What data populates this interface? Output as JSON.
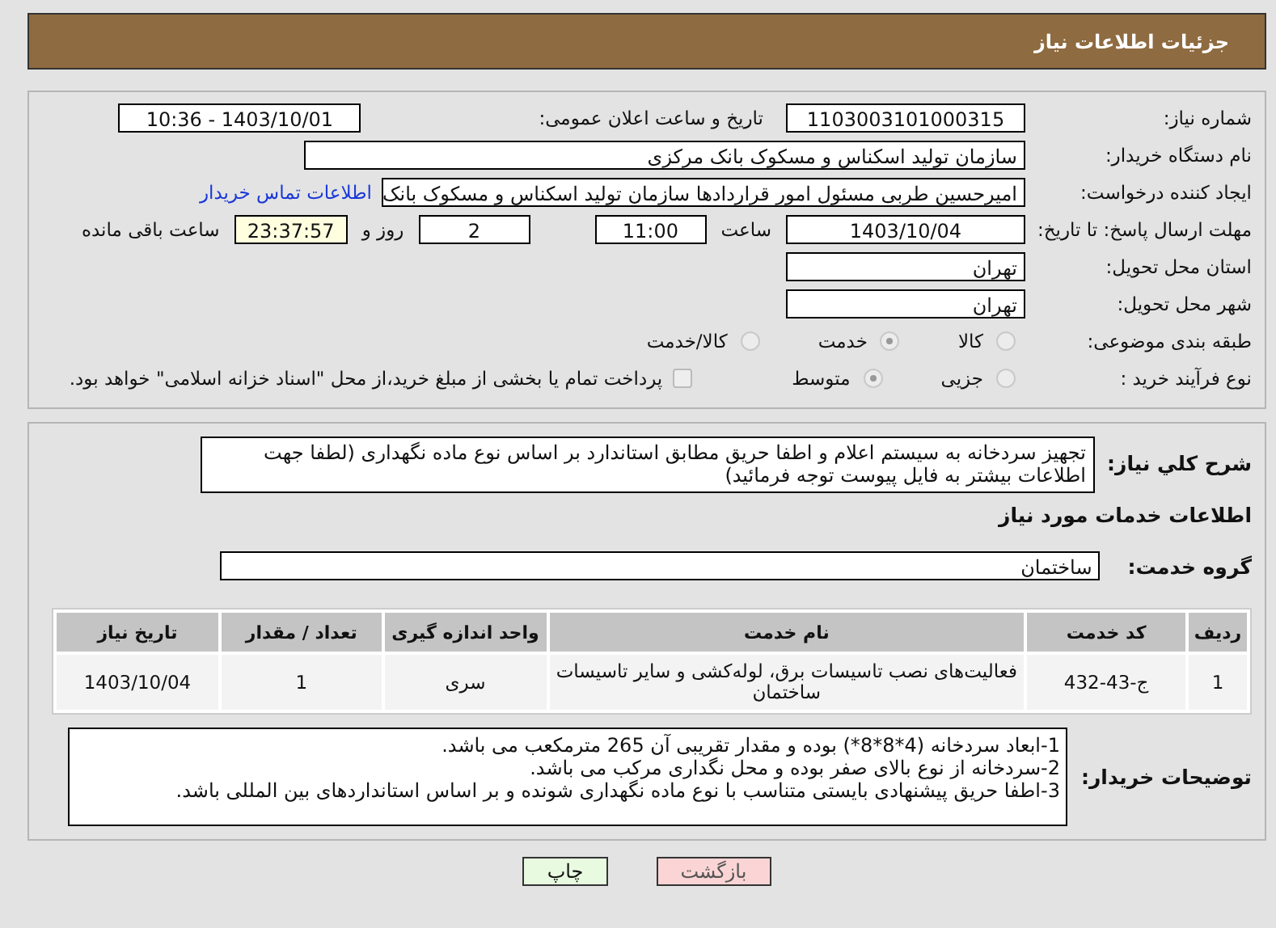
{
  "header": {
    "title": "جزئیات اطلاعات نیاز"
  },
  "form": {
    "need_number": {
      "label": "شماره نیاز:",
      "value": "1103003101000315"
    },
    "announce": {
      "label": "تاریخ و ساعت اعلان عمومی:",
      "value": "1403/10/01 - 10:36"
    },
    "buyer": {
      "label": "نام دستگاه خریدار:",
      "value": "سازمان تولید اسکناس و مسکوک بانک مرکزی"
    },
    "creator": {
      "label": "ایجاد کننده درخواست:",
      "value": "امیرحسین طربی مسئول امور قراردادها سازمان تولید اسکناس و مسکوک بانک",
      "link": "اطلاعات تماس خریدار"
    },
    "deadline": {
      "label": "مهلت ارسال پاسخ: تا تاریخ:",
      "date": "1403/10/04",
      "time_label": "ساعت",
      "time": "11:00",
      "days": "2",
      "days_label": "روز و",
      "remaining": "23:37:57",
      "remaining_label": "ساعت باقی مانده"
    },
    "province": {
      "label": "استان محل تحویل:",
      "value": "تهران"
    },
    "city": {
      "label": "شهر محل تحویل:",
      "value": "تهران"
    },
    "category": {
      "label": "طبقه بندی موضوعی:",
      "options": [
        {
          "label": "کالا",
          "selected": false
        },
        {
          "label": "خدمت",
          "selected": true
        },
        {
          "label": "کالا/خدمت",
          "selected": false
        }
      ]
    },
    "process": {
      "label": "نوع فرآیند خرید :",
      "options": [
        {
          "label": "جزیی",
          "selected": false
        },
        {
          "label": "متوسط",
          "selected": true
        }
      ],
      "payment": {
        "checked": false,
        "text": "پرداخت تمام یا بخشی از مبلغ خرید،از محل \"اسناد خزانه اسلامی\" خواهد بود."
      }
    }
  },
  "details": {
    "description": {
      "label": "شرح کلي نياز:",
      "value": "تجهیز سردخانه به سیستم اعلام و اطفا حریق مطابق استاندارد بر اساس نوع ماده نگهداری (لطفا جهت اطلاعات بیشتر به فایل پیوست توجه فرمائید)"
    },
    "services_heading": "اطلاعات خدمات مورد نیاز",
    "group": {
      "label": "گروه خدمت:",
      "value": "ساختمان"
    },
    "table": {
      "columns": [
        "ردیف",
        "کد خدمت",
        "نام خدمت",
        "واحد اندازه گیری",
        "تعداد / مقدار",
        "تاریخ نیاز"
      ],
      "rows": [
        [
          "1",
          "ج-43-432",
          "فعالیت‌های نصب تاسیسات برق، لوله‌کشی و سایر تاسیسات ساختمان",
          "سری",
          "1",
          "1403/10/04"
        ]
      ]
    },
    "notes": {
      "label": "توضیحات خریدار:",
      "lines": [
        "1-ابعاد سردخانه (4*8*8*) بوده و مقدار تقریبی آن 265 مترمکعب می باشد.",
        "2-سردخانه از نوع بالای صفر بوده و محل نگداری مرکب می باشد.",
        "3-اطفا حریق پیشنهادی بایستی متناسب با نوع ماده نگهداری شونده و بر اساس استانداردهای بین المللی باشد."
      ]
    }
  },
  "buttons": [
    {
      "label": "بازگشت",
      "kind": "back"
    },
    {
      "label": "چاپ",
      "kind": "print"
    }
  ]
}
